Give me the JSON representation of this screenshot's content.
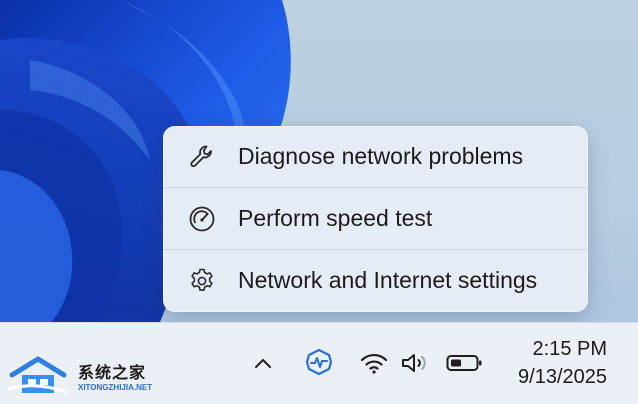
{
  "menu": {
    "items": [
      {
        "label": "Diagnose network problems",
        "icon": "wrench-icon"
      },
      {
        "label": "Perform speed test",
        "icon": "speedometer-icon"
      },
      {
        "label": "Network and Internet settings",
        "icon": "gear-icon"
      }
    ]
  },
  "taskbar": {
    "tray_icons": [
      "chevron-up-icon",
      "app-tray-icon",
      "wifi-icon",
      "volume-icon",
      "battery-icon"
    ],
    "clock": {
      "time": "2:15 PM",
      "date": "9/13/2025"
    }
  },
  "watermark": {
    "title": "系统之家",
    "subtitle": "XITONGZHIJIA.NET"
  },
  "colors": {
    "menu_bg": "#e6ecf5",
    "taskbar_bg": "#ebeff6",
    "wallpaper_blue": "#1a4fd6",
    "accent": "#2f6fc9"
  }
}
